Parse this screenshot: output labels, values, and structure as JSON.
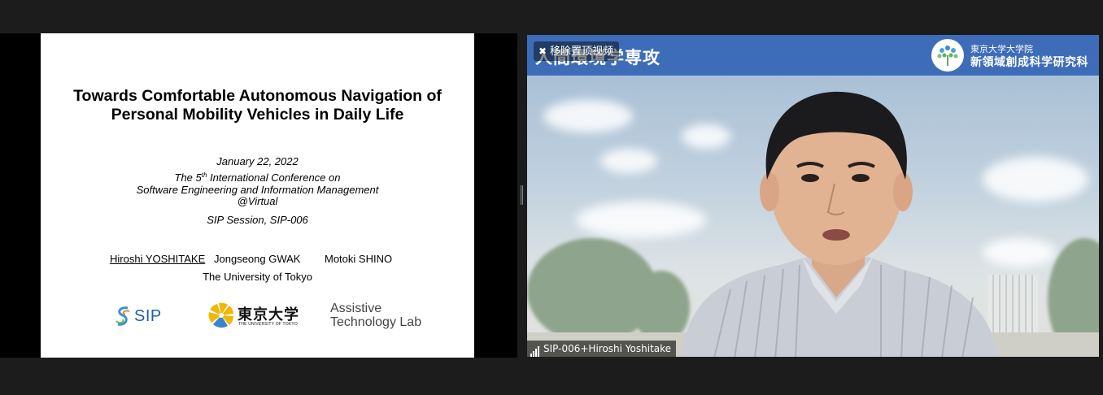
{
  "shared_screen": {
    "slide": {
      "title_lines": [
        "Towards Comfortable Autonomous Navigation of",
        "Personal Mobility Vehicles in Daily Life"
      ],
      "date": "January 22, 2022",
      "conference_prefix": "The 5",
      "conference_ordinal": "th",
      "conference_suffix": " International Conference on",
      "conference_line2": "Software Engineering and Information Management",
      "conference_line3": "@Virtual",
      "session": "SIP Session, SIP-006",
      "authors": [
        "Hiroshi YOSHITAKE",
        "Jongseong GWAK",
        "Motoki SHINO"
      ],
      "affiliation": "The University of Tokyo",
      "logos": {
        "sip": "SIP",
        "utokyo_jp": "東京大学",
        "utokyo_en": "THE UNIVERSITY OF TOKYO",
        "atl_line1": "Assistive",
        "atl_line2": "Technology Lab"
      }
    }
  },
  "video": {
    "unpin_label": "移除置顶视频",
    "banner_text": "人間環境学専攻",
    "university_line1": "東京大学大学院",
    "university_line2": "新領域創成科学研究科",
    "participant_name": "SIP-006+Hiroshi Yoshitake"
  },
  "colors": {
    "background": "#1c1c1c",
    "banner": "#3d6db9",
    "sip_blue": "#1e5fb0",
    "utokyo_yellow": "#f2b705"
  },
  "icons": [
    "pin-icon",
    "signal-strength-icon",
    "sip-logo",
    "utokyo-ginkgo-logo",
    "university-tree-logo"
  ]
}
